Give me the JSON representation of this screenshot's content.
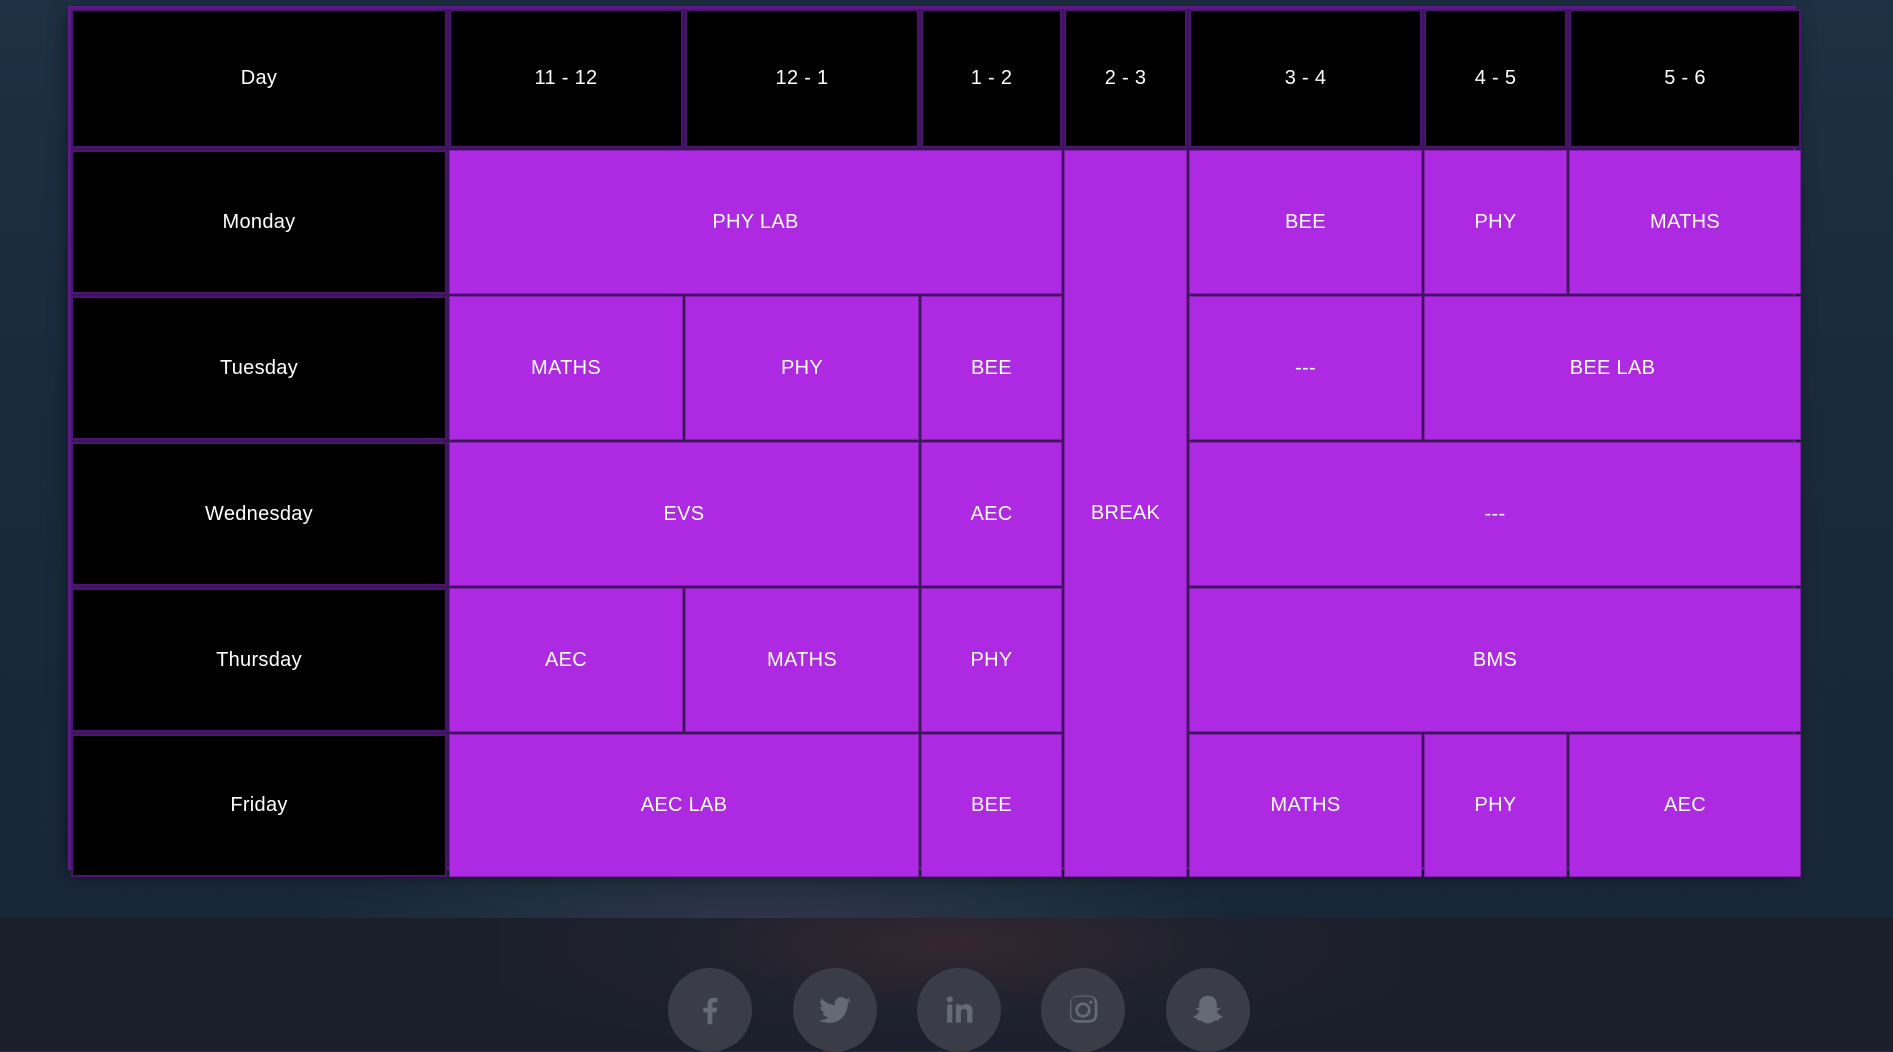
{
  "timetable": {
    "header": {
      "day": "Day",
      "slots": [
        "11 - 12",
        "12 - 1",
        "1 - 2",
        "2 - 3",
        "3 - 4",
        "4 - 5",
        "5 - 6"
      ]
    },
    "days": [
      "Monday",
      "Tuesday",
      "Wednesday",
      "Thursday",
      "Friday"
    ],
    "break_label": "BREAK",
    "monday": {
      "phy_lab": "PHY LAB",
      "bee": "BEE",
      "phy": "PHY",
      "maths": "MATHS"
    },
    "tuesday": {
      "maths": "MATHS",
      "phy": "PHY",
      "bee": "BEE",
      "free": "---",
      "bee_lab": "BEE LAB"
    },
    "wednesday": {
      "evs": "EVS",
      "aec": "AEC",
      "free": "---"
    },
    "thursday": {
      "aec": "AEC",
      "maths": "MATHS",
      "phy": "PHY",
      "bms": "BMS"
    },
    "friday": {
      "aec_lab": "AEC LAB",
      "bee": "BEE",
      "maths": "MATHS",
      "phy": "PHY",
      "aec": "AEC"
    }
  },
  "footer": {
    "social_icons": [
      "facebook-icon",
      "twitter-icon",
      "linkedin-icon",
      "instagram-icon",
      "snapchat-icon"
    ]
  },
  "colors": {
    "cell_purple": "#ad29e2",
    "header_black": "#000000",
    "border_purple": "#5b1a86"
  }
}
